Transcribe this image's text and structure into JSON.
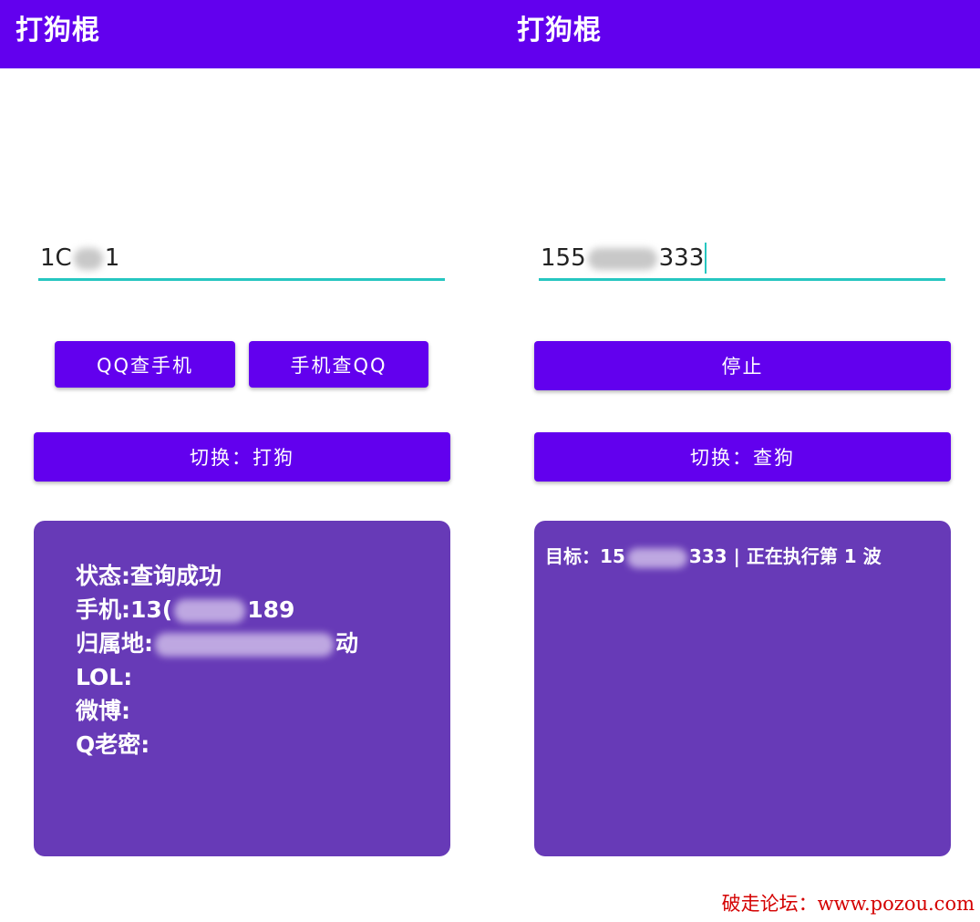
{
  "app_bar": {
    "left_title": "打狗棍",
    "right_title": "打狗棍"
  },
  "left": {
    "input": {
      "prefix": "1C",
      "suffix": "1"
    },
    "buttons": {
      "qq_to_phone": "QQ查手机",
      "phone_to_qq": "手机查QQ",
      "switch": "切换：打狗"
    },
    "result": {
      "status": "状态:查询成功",
      "phone_prefix": "手机:13(",
      "phone_suffix": "189",
      "location_prefix": "归属地:",
      "location_suffix": "动",
      "lol": "LOL:",
      "weibo": "微博:",
      "q_password": "Q老密:"
    }
  },
  "right": {
    "input": {
      "prefix": "155",
      "suffix": "333"
    },
    "buttons": {
      "stop": "停止",
      "switch": "切换：查狗"
    },
    "status": {
      "prefix": "目标：15",
      "suffix": "333 | 正在执行第 1 波"
    }
  },
  "watermark": "破走论坛：www.pozou.com",
  "colors": {
    "primary": "#6200ee",
    "panel": "#673ab7",
    "accent": "#26c6c0",
    "watermark": "#d40000"
  }
}
